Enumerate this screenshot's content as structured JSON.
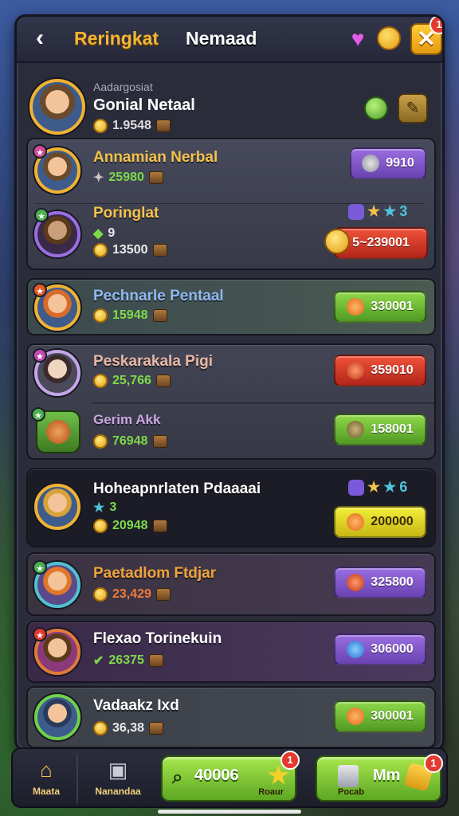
{
  "header": {
    "title_a": "Reringkat",
    "title_b": "Nemaad",
    "back_icon": "back-arrow-icon",
    "close_label": "✕",
    "close_badge": "1"
  },
  "profile": {
    "small_label": "Aadargosiat",
    "name": "Gonial Netaal",
    "coins": "1.9548"
  },
  "rows": [
    {
      "name": "Annamian Nerbal",
      "value": "25980",
      "pill": "9910",
      "name_color": "#f4c24a"
    },
    {
      "name": "Poringlat",
      "value": "13500",
      "sub": "9",
      "pill": "5~239001",
      "stars_a": "★",
      "stars_b": "3",
      "name_color": "#f08a3a"
    },
    {
      "name": "Pechnarle Pentaal",
      "value": "15948",
      "pill": "330001",
      "name_color": "#8fb8f0"
    },
    {
      "name": "Peskarakala Pigi",
      "value": "25,766",
      "pill": "359010",
      "name_color": "#e8b7a4"
    },
    {
      "name": "Gerim Akk",
      "value": "76948",
      "pill": "158001",
      "name_color": "#c9a7e0"
    },
    {
      "name": "Hoheapnrlaten Pdaaaai",
      "value": "20948",
      "sub": "3",
      "pill": "200000",
      "stars_b": "6",
      "name_color": "#ffffff"
    },
    {
      "name": "Paetadlom Ftdjar",
      "value": "23,429",
      "pill": "325800",
      "name_color": "#f0a23a"
    },
    {
      "name": "Flexao Torinekuin",
      "value": "26375",
      "pill": "306000",
      "name_color": "#ffffff"
    },
    {
      "name": "Vadaakz Ixd",
      "value": "36,38",
      "pill": "300001",
      "name_color": "#ffffff"
    }
  ],
  "bottom": {
    "home_label": "Maata",
    "shop_label": "Nanandaa",
    "search_value": "40006",
    "search_sub": "Roaur",
    "search_badge": "1",
    "mm_label": "Mm",
    "mm_sub": "Pocab",
    "mm_badge": "1"
  },
  "colors": {
    "accent": "#f5b634",
    "green": "#5ca722",
    "purple": "#6a42b2",
    "red": "#b3251a",
    "panel": "#2b2c3a"
  }
}
